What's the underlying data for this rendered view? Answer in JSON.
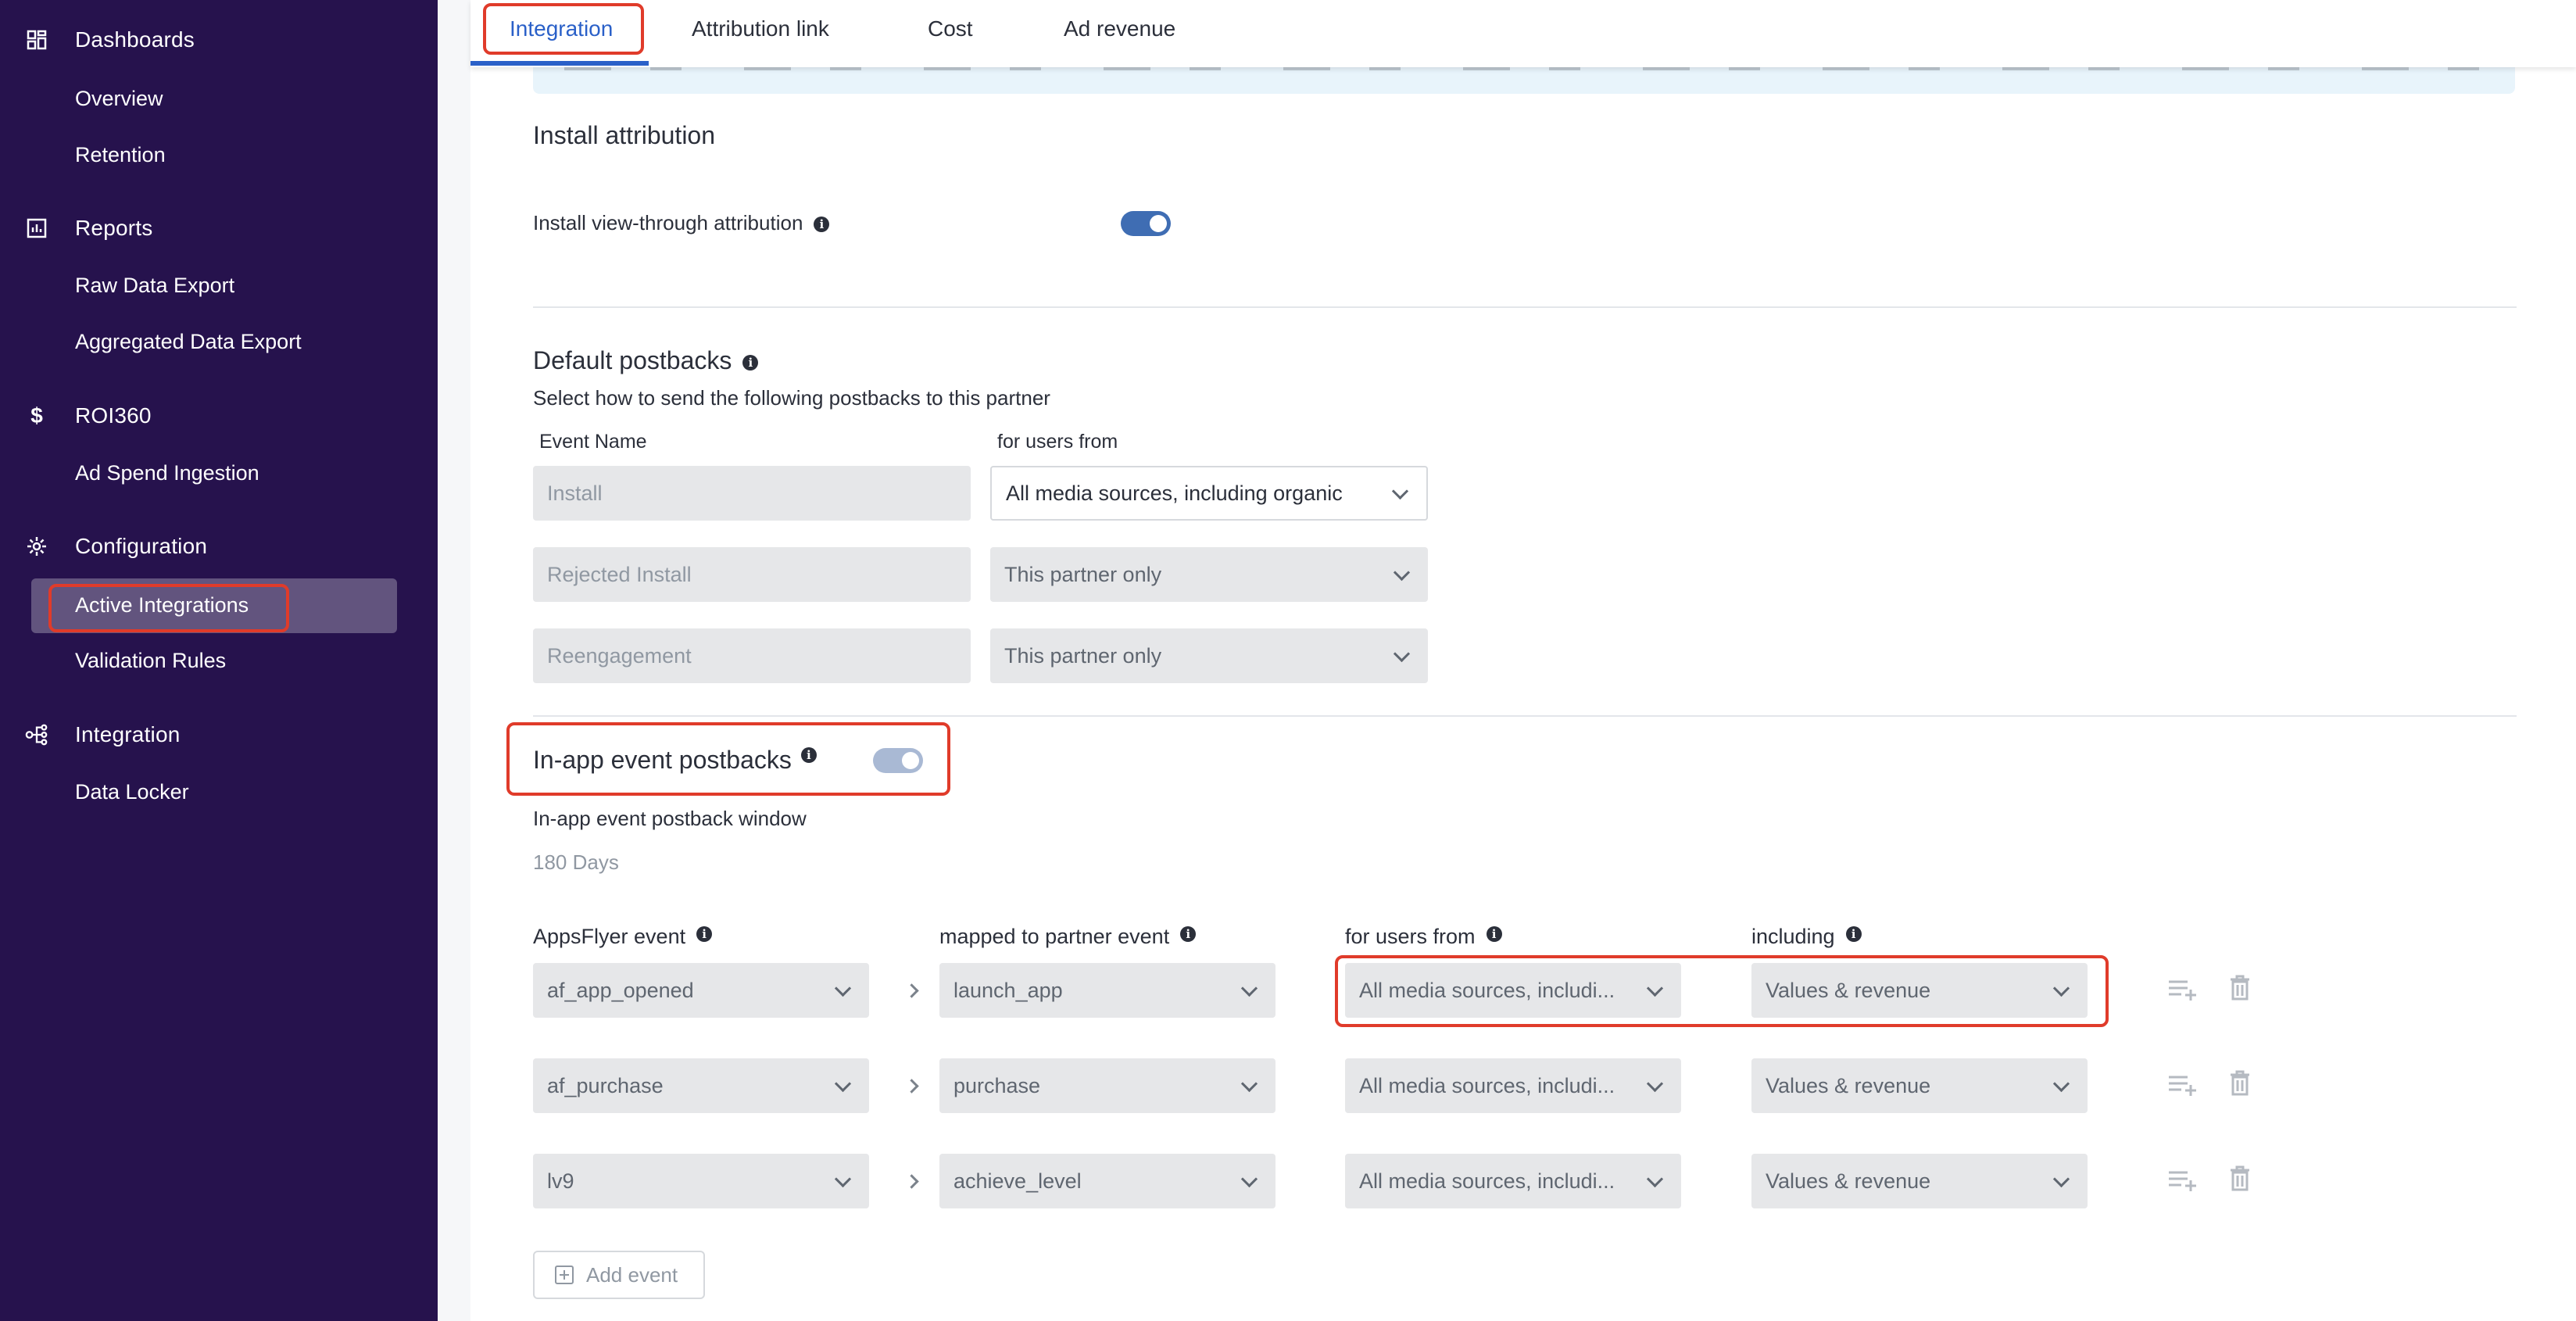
{
  "sidebar": {
    "sections": [
      {
        "label": "Dashboards",
        "icon": "dashboard-grid-icon",
        "items": [
          "Overview",
          "Retention"
        ]
      },
      {
        "label": "Reports",
        "icon": "reports-chart-icon",
        "items": [
          "Raw Data Export",
          "Aggregated Data Export"
        ]
      },
      {
        "label": "ROI360",
        "icon": "dollar-icon",
        "items": [
          "Ad Spend Ingestion"
        ]
      },
      {
        "label": "Configuration",
        "icon": "gear-icon",
        "items": [
          "Active Integrations",
          "Validation Rules"
        ]
      },
      {
        "label": "Integration",
        "icon": "integration-nodes-icon",
        "items": [
          "Data Locker"
        ]
      }
    ],
    "active_item": "Active Integrations"
  },
  "tabs": [
    {
      "label": "Integration",
      "active": true
    },
    {
      "label": "Attribution link",
      "active": false
    },
    {
      "label": "Cost",
      "active": false
    },
    {
      "label": "Ad revenue",
      "active": false
    }
  ],
  "install_attribution": {
    "title": "Install attribution",
    "view_through_label": "Install view-through attribution",
    "view_through_enabled": true
  },
  "default_postbacks": {
    "title": "Default postbacks",
    "subtitle": "Select how to send the following postbacks to this partner",
    "col_event_name": "Event Name",
    "col_users_from": "for users from",
    "rows": [
      {
        "event": "Install",
        "users_from": "All media sources, including organic"
      },
      {
        "event": "Rejected Install",
        "users_from": "This partner only"
      },
      {
        "event": "Reengagement",
        "users_from": "This partner only"
      }
    ]
  },
  "in_app": {
    "title": "In-app event postbacks",
    "enabled": true,
    "window_label": "In-app event postback window",
    "window_value": "180 Days",
    "col_af_event": "AppsFlyer event",
    "col_partner_event": "mapped to partner event",
    "col_users_from": "for users from",
    "col_including": "including",
    "rows": [
      {
        "af_event": "af_app_opened",
        "partner_event": "launch_app",
        "users_from": "All media sources, includi...",
        "including": "Values & revenue"
      },
      {
        "af_event": "af_purchase",
        "partner_event": "purchase",
        "users_from": "All media sources, includi...",
        "including": "Values & revenue"
      },
      {
        "af_event": "lv9",
        "partner_event": "achieve_level",
        "users_from": "All media sources, includi...",
        "including": "Values & revenue"
      }
    ],
    "add_event_label": "Add event"
  },
  "colors": {
    "sidebar_bg": "#26124d",
    "accent": "#2a60c8",
    "highlight_box": "#e03b2a",
    "toggle_on": "#3f6db3"
  }
}
